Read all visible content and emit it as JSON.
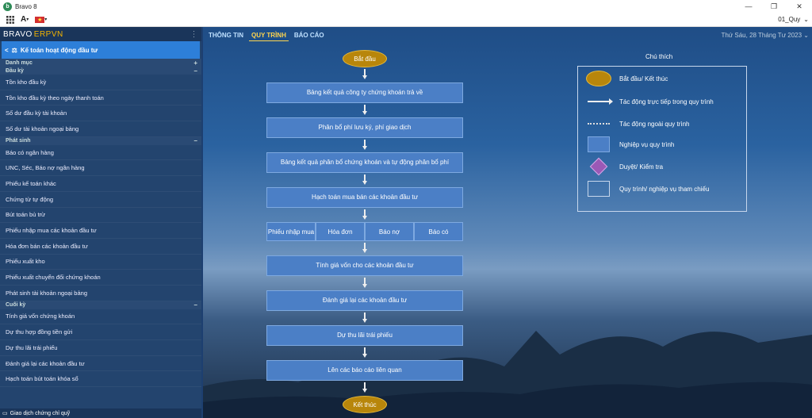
{
  "window": {
    "app_logo_letter": "b",
    "title": "Bravo 8",
    "controls": [
      "—",
      "❐",
      "✕"
    ]
  },
  "toolbar": {
    "grid_icon": "grid-icon",
    "font_icon_label": "A",
    "flag_glyph": "★",
    "company": "01_Quy",
    "company_chevron": "⌄"
  },
  "sidebar": {
    "brand_left": "BRAVO",
    "brand_right": "ERPVN",
    "brand_menu": "⋮",
    "module_back": "<",
    "module_title": "Kế toán hoạt động đầu tư",
    "sections": [
      {
        "title": "Danh mục",
        "toggle": "+",
        "items": []
      },
      {
        "title": "Đầu kỳ",
        "toggle": "–",
        "items": [
          "Tồn kho đầu kỳ",
          "Tồn kho đầu kỳ theo ngày thanh toán",
          "Số dư đầu kỳ tài khoản",
          "Số dư tài khoản ngoại bảng"
        ]
      },
      {
        "title": "Phát sinh",
        "toggle": "–",
        "items": [
          "Báo có ngân hàng",
          "UNC, Séc, Báo nợ ngân hàng",
          "Phiếu kế toán khác",
          "Chứng từ tự động",
          "Bút toán bù trừ",
          "Phiếu nhập mua các khoản đầu tư",
          "Hóa đơn bán các khoản đầu tư",
          "Phiếu xuất kho",
          "Phiếu xuất chuyển đổi chứng khoán",
          "Phát sinh tài khoản ngoại bảng"
        ]
      },
      {
        "title": "Cuối kỳ",
        "toggle": "–",
        "items": [
          "Tính giá vốn chứng khoán",
          "Dự thu hợp đồng tiền gửi",
          "Dự thu lãi trái phiếu",
          "Đánh giá lại các khoản đầu tư",
          "Hạch toán bút toán khóa sổ"
        ]
      }
    ],
    "footer": "Giao dịch chứng chỉ quỹ"
  },
  "main": {
    "tabs": [
      {
        "label": "THÔNG TIN",
        "active": false
      },
      {
        "label": "QUY TRÌNH",
        "active": true
      },
      {
        "label": "BÁO CÁO",
        "active": false
      }
    ],
    "date": "Thứ Sáu, 28 Tháng Tư 2023",
    "date_chevron": "⌄",
    "flow": {
      "start": "Bắt đầu",
      "steps": [
        "Bảng kết quả công ty chứng khoán trả về",
        "Phân bổ phí lưu ký, phí giao dịch",
        "Bảng kết quả phân bổ chứng khoán và tự động phân bổ phí",
        "Hạch toán mua bán các khoản đầu tư"
      ],
      "sub_steps": [
        "Phiếu nhập mua",
        "Hóa đơn",
        "Báo nợ",
        "Báo có"
      ],
      "steps_after": [
        "Tính giá vốn cho các khoản đầu tư",
        "Đánh giá lại các khoản đầu tư",
        "Dự thu lãi trái phiếu",
        "Lên các báo cáo liên quan"
      ],
      "end": "Kết thúc"
    },
    "legend": {
      "title": "Chú thích",
      "items": [
        {
          "symbol": "oval",
          "label": "Bắt đầu/ Kết thúc"
        },
        {
          "symbol": "arrow",
          "label": "Tác động trực tiếp trong quy trình"
        },
        {
          "symbol": "dots",
          "label": "Tác động ngoài quy trình"
        },
        {
          "symbol": "box",
          "label": "Nghiệp vụ quy trình"
        },
        {
          "symbol": "diamond",
          "label": "Duyệt/ Kiểm tra"
        },
        {
          "symbol": "ref",
          "label": "Quy trình/ nghiệp vụ tham chiếu"
        }
      ]
    }
  }
}
